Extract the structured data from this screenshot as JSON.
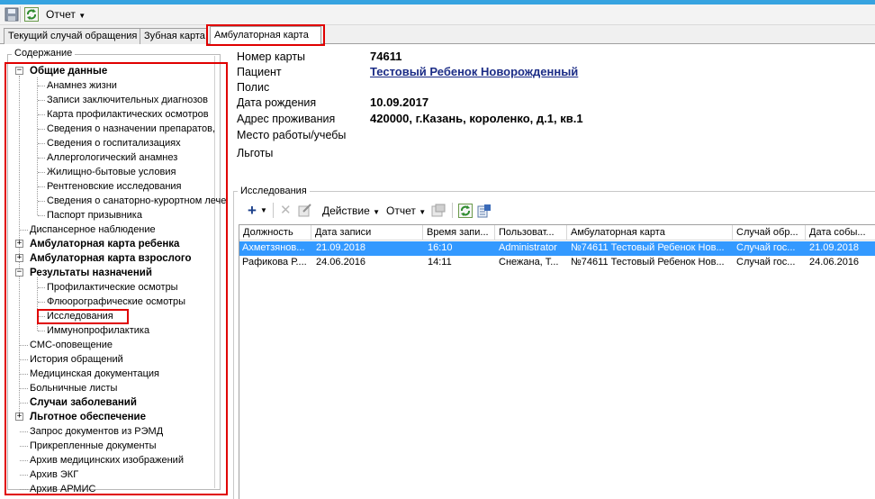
{
  "toolbar": {
    "report_menu": "Отчет"
  },
  "tabs": [
    {
      "label": "Текущий случай обращения"
    },
    {
      "label": "Зубная карта"
    },
    {
      "label": "Амбулаторная карта"
    }
  ],
  "contents": {
    "title": "Содержание",
    "items": [
      {
        "label": "Общие данные",
        "bold": true,
        "expander": "−"
      },
      {
        "label": "Анамнез жизни"
      },
      {
        "label": "Записи заключительных диагнозов"
      },
      {
        "label": "Карта профилактических осмотров"
      },
      {
        "label": "Сведения о назначении препаратов,"
      },
      {
        "label": "Сведения о госпитализациях"
      },
      {
        "label": "Аллергологический анамнез"
      },
      {
        "label": "Жилищно-бытовые условия"
      },
      {
        "label": "Рентгеновские исследования"
      },
      {
        "label": "Сведения о санаторно-курортном лече"
      },
      {
        "label": "Паспорт призывника"
      },
      {
        "label": "Диспансерное наблюдение"
      },
      {
        "label": "Амбулаторная карта ребенка",
        "bold": true,
        "expander": "+"
      },
      {
        "label": "Амбулаторная карта взрослого",
        "bold": true,
        "expander": "+"
      },
      {
        "label": "Результаты назначений",
        "bold": true,
        "expander": "−"
      },
      {
        "label": "Профилактические осмотры"
      },
      {
        "label": "Флюорографические осмотры"
      },
      {
        "label": "Исследования"
      },
      {
        "label": "Иммунопрофилактика"
      },
      {
        "label": "СМС-оповещение"
      },
      {
        "label": "История обращений"
      },
      {
        "label": "Медицинская документация"
      },
      {
        "label": "Больничные листы"
      },
      {
        "label": "Случаи заболеваний",
        "bold": true
      },
      {
        "label": "Льготное обеспечение",
        "bold": true,
        "expander": "+"
      },
      {
        "label": "Запрос документов из РЭМД"
      },
      {
        "label": "Прикрепленные документы"
      },
      {
        "label": "Архив медицинских изображений"
      },
      {
        "label": "Архив ЭКГ"
      },
      {
        "label": "Архив АРМИС"
      }
    ]
  },
  "card": {
    "number_label": "Номер карты",
    "number_value": "74611",
    "patient_label": "Пациент",
    "patient_value": "Тестовый Ребенок Новорожденный",
    "policy_label": "Полис",
    "birth_label": "Дата рождения",
    "birth_value": "10.09.2017",
    "address_label": "Адрес проживания",
    "address_value": "420000, г.Казань, короленко, д.1, кв.1",
    "work_label": "Место работы/учебы",
    "benefits_label": "Льготы"
  },
  "research": {
    "title": "Исследования",
    "action_menu": "Действие",
    "report_menu": "Отчет",
    "columns": [
      "Должность",
      "Дата записи",
      "Время запи...",
      "Пользоват...",
      "Амбулаторная карта",
      "Случай обр...",
      "Дата собы..."
    ],
    "rows": [
      [
        "Ахметзянов...",
        "21.09.2018",
        "16:10",
        "Administrator",
        "№74611 Тестовый Ребенок Нов...",
        "Случай гос...",
        "21.09.2018"
      ],
      [
        "Рафикова Р....",
        "24.06.2016",
        "14:11",
        "Снежана, Т...",
        "№74611 Тестовый Ребенок Нов...",
        "Случай гос...",
        "24.06.2016"
      ]
    ]
  },
  "colors": {
    "accent": "#36a3e0",
    "highlight": "#e00000",
    "selection": "#3399ff",
    "link": "#1b2c86"
  }
}
